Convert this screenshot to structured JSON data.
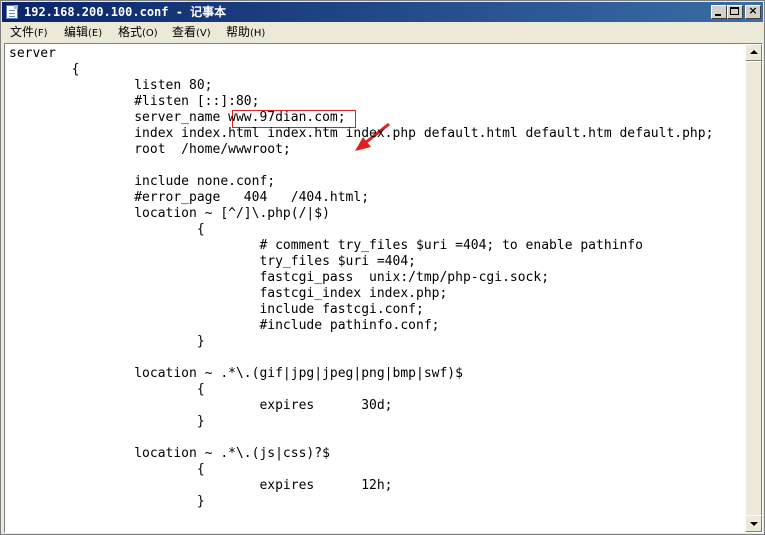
{
  "window": {
    "title": "192.168.200.100.conf - 记事本"
  },
  "menu": [
    {
      "label": "文件",
      "hotkey": "(F)"
    },
    {
      "label": "编辑",
      "hotkey": "(E)"
    },
    {
      "label": "格式",
      "hotkey": "(O)"
    },
    {
      "label": "查看",
      "hotkey": "(V)"
    },
    {
      "label": "帮助",
      "hotkey": "(H)"
    }
  ],
  "editor": {
    "lines": [
      "server",
      "        {",
      "                listen 80;",
      "                #listen [::]:80;",
      "                server_name www.97dian.com;",
      "                index index.html index.htm index.php default.html default.htm default.php;",
      "                root  /home/wwwroot;",
      "",
      "                include none.conf;",
      "                #error_page   404   /404.html;",
      "                location ~ [^/]\\.php(/|$)",
      "                        {",
      "                                # comment try_files $uri =404; to enable pathinfo",
      "                                try_files $uri =404;",
      "                                fastcgi_pass  unix:/tmp/php-cgi.sock;",
      "                                fastcgi_index index.php;",
      "                                include fastcgi.conf;",
      "                                #include pathinfo.conf;",
      "                        }",
      "",
      "                location ~ .*\\.(gif|jpg|jpeg|png|bmp|swf)$",
      "                        {",
      "                                expires      30d;",
      "                        }",
      "",
      "                location ~ .*\\.(js|css)?$",
      "                        {",
      "                                expires      12h;",
      "                        }"
    ]
  },
  "colors": {
    "titlebar_start": "#0a246a",
    "titlebar_end": "#3a6ea5",
    "annotation": "#e02020"
  },
  "icons": {
    "app": "notepad-icon",
    "minimize": "minimize-icon",
    "maximize": "maximize-icon",
    "close": "close-icon"
  }
}
